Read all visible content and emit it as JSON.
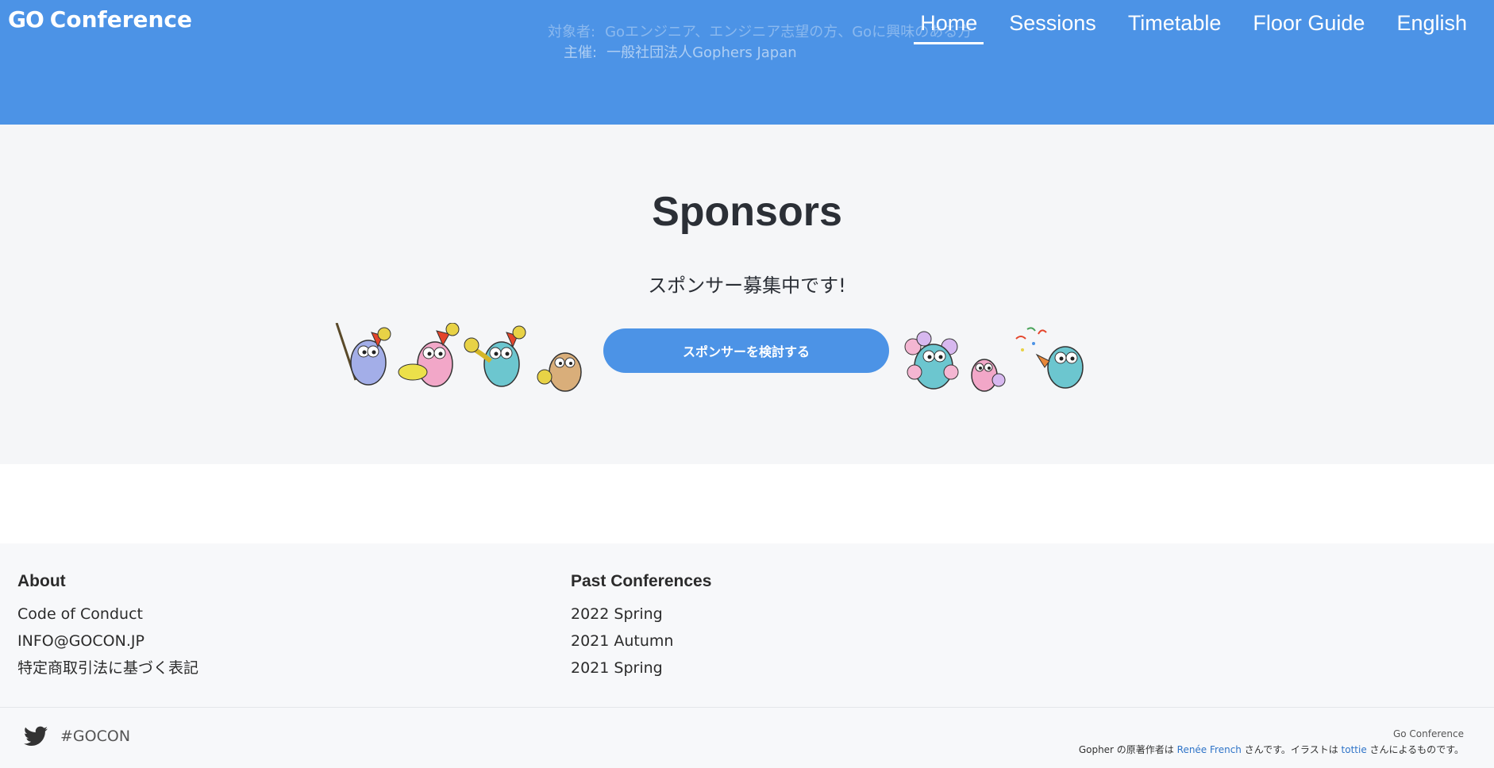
{
  "header": {
    "logo_go": "GO",
    "logo_text": "Conference",
    "target_label": "対象者:",
    "target_value": "Goエンジニア、エンジニア志望の方、Goに興味のある方",
    "host_label": "主催:",
    "host_value": "一般社団法人Gophers Japan"
  },
  "nav": {
    "items": [
      {
        "label": "Home",
        "active": true
      },
      {
        "label": "Sessions"
      },
      {
        "label": "Timetable"
      },
      {
        "label": "Floor Guide"
      },
      {
        "label": "English"
      }
    ]
  },
  "sponsors": {
    "title": "Sponsors",
    "subtitle": "スポンサー募集中です!",
    "cta_label": "スポンサーを検討する"
  },
  "footer": {
    "about_heading": "About",
    "about_links": [
      "Code of Conduct",
      "INFO@GOCON.JP",
      "特定商取引法に基づく表記"
    ],
    "past_heading": "Past Conferences",
    "past_links": [
      "2022 Spring",
      "2021 Autumn",
      "2021 Spring"
    ],
    "hashtag": "#GOCON",
    "credit_brand": "Go Conference",
    "credit_pre": "Gopher の原著作者は",
    "credit_author": "Renée French",
    "credit_mid": "さんです。イラストは",
    "credit_illustrator": "tottie",
    "credit_post": "さんによるものです。"
  },
  "colors": {
    "primary": "#4c93e6",
    "link": "#2f74c8",
    "section_bg": "#f5f6f8"
  }
}
